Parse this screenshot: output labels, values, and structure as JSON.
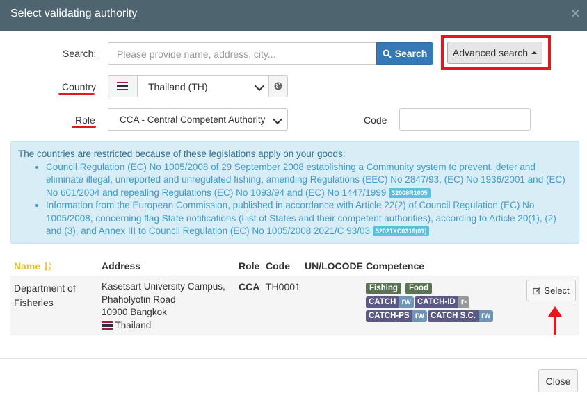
{
  "modal": {
    "title": "Select validating authority"
  },
  "search": {
    "label": "Search:",
    "placeholder": "Please provide name, address, city...",
    "button": "Search",
    "advanced": "Advanced search"
  },
  "country": {
    "label": "Country",
    "value": "Thailand (TH)"
  },
  "role": {
    "label": "Role",
    "value": "CCA - Central Competent Authority"
  },
  "code": {
    "label": "Code",
    "value": ""
  },
  "info": {
    "intro": "The countries are restricted because of these legislations apply on your goods:",
    "items": [
      {
        "text": "Council Regulation (EC) No 1005/2008 of 29 September 2008 establishing a Community system to prevent, deter and eliminate illegal, unreported and unregulated fishing, amending Regulations (EEC) No 2847/93, (EC) No 1936/2001 and (EC) No 601/2004 and repealing Regulations (EC) No 1093/94 and (EC) No 1447/1999",
        "code": "32008R1005"
      },
      {
        "text": "Information from the European Commission, published in accordance with Article 22(2) of Council Regulation (EC) No 1005/2008, concerning flag State notifications (List of States and their competent authorities), according to Article 20(1), (2) and (3), and Annex III to Council Regulation (EC) No 1005/2008 2021/C 93/03",
        "code": "52021XC0319(01)"
      }
    ]
  },
  "table": {
    "headers": {
      "name": "Name",
      "address": "Address",
      "role": "Role",
      "code": "Code",
      "unlocode": "UN/LOCODE",
      "competence": "Competence"
    },
    "row": {
      "name_line1": "Department of",
      "name_line2": "Fisheries",
      "address_line1": "Kasetsart University Campus,",
      "address_line2": "Phaholyotin Road",
      "address_line3": "10900 Bangkok",
      "address_country": "Thailand",
      "role": "CCA",
      "code": "TH0001",
      "tags": [
        "Fishing",
        "Food"
      ],
      "competences": [
        {
          "name": "CATCH",
          "access": "rw"
        },
        {
          "name": "CATCH-ID",
          "access": "r-"
        },
        {
          "name": "CATCH-PS",
          "access": "rw"
        },
        {
          "name": "CATCH S.C.",
          "access": "rw"
        }
      ],
      "select": "Select"
    }
  },
  "footer": {
    "close": "Close"
  },
  "colors": {
    "header_bg": "#4e6570",
    "primary": "#337ab7",
    "highlight": "#e4171f",
    "name_header": "#e6c12b"
  }
}
